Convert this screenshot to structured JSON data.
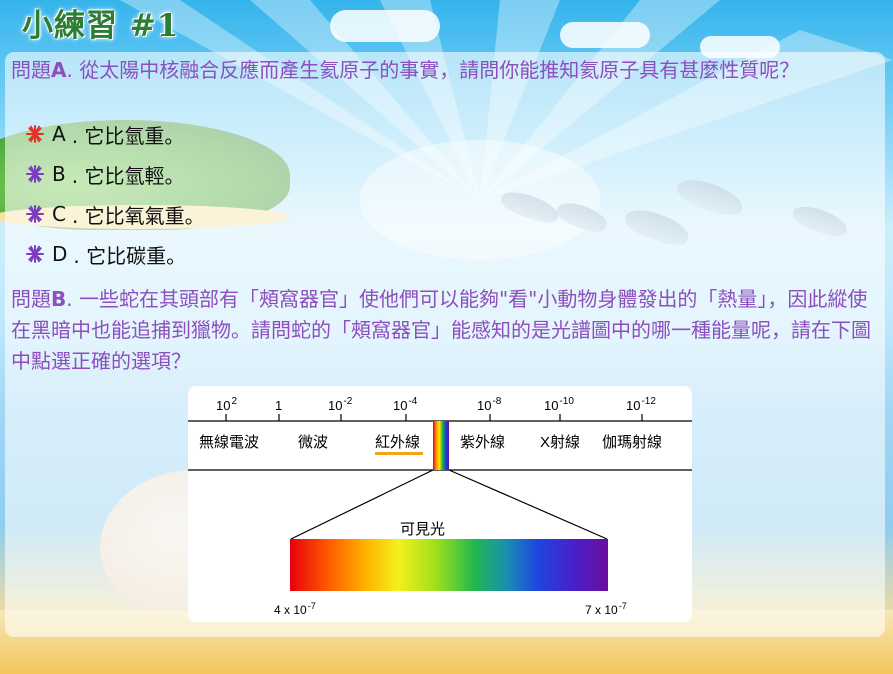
{
  "title": "小練習 #1",
  "question_a": {
    "prefix": "問題",
    "letter": "A",
    "text": ". 從太陽中核融合反應而產生氦原子的事實，請問你能推知氦原子具有甚麼性質呢？"
  },
  "options": [
    {
      "letter": "A",
      "text": ". 它比氫重。",
      "bullet_color": "#e2332b"
    },
    {
      "letter": "B",
      "text": ". 它比氫輕。",
      "bullet_color": "#7b3cc0"
    },
    {
      "letter": "C",
      "text": ". 它比氧氣重。",
      "bullet_color": "#7b3cc0"
    },
    {
      "letter": "D",
      "text": ". 它比碳重。",
      "bullet_color": "#7b3cc0"
    }
  ],
  "question_b": {
    "prefix": "問題",
    "letter": "B",
    "text": ". 一些蛇在其頭部有「頰窩器官」使他們可以能夠\"看\"小動物身體發出的「熱量」，因此縱使在黑暗中也能追捕到獵物。請問蛇的「頰窩器官」能感知的是光譜圖中的哪一種能量呢，請在下圖中點選正確的選項？"
  },
  "spectrum": {
    "scale_labels": [
      {
        "base": "10",
        "exp": "2"
      },
      {
        "base": "1",
        "exp": ""
      },
      {
        "base": "10",
        "exp": "-2"
      },
      {
        "base": "10",
        "exp": "-4"
      },
      {
        "base": "10",
        "exp": "-8"
      },
      {
        "base": "10",
        "exp": "-10"
      },
      {
        "base": "10",
        "exp": "-12"
      }
    ],
    "bands": [
      "無線電波",
      "微波",
      "紅外線",
      "紫外線",
      "X射線",
      "伽瑪射線"
    ],
    "selected_band": "紅外線",
    "highlight_color": "#f2a51a",
    "visible_label": "可見光",
    "left_wavelength": {
      "base": "4 x 10",
      "exp": "-7"
    },
    "right_wavelength": {
      "base": "7 x 10",
      "exp": "-7"
    }
  },
  "colors": {
    "title": "#2d7d35",
    "question_text": "#8c4fbd",
    "option_text": "#111111"
  }
}
